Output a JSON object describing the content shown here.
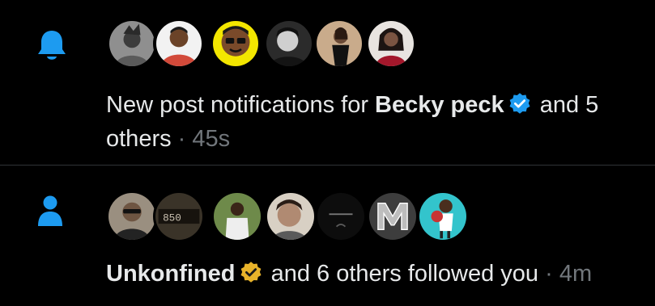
{
  "notifications": [
    {
      "type_icon": "bell-icon",
      "avatars": [
        "avatar-1",
        "avatar-2",
        "avatar-3",
        "avatar-4",
        "avatar-5",
        "avatar-6"
      ],
      "text_prefix": "New post notifications for",
      "user": "Becky peck",
      "badge": "verified-blue-icon",
      "text_suffix": "and 5",
      "text_line2": "others",
      "separator": "·",
      "time": "45s"
    },
    {
      "type_icon": "person-icon",
      "avatars": [
        "avatar-1",
        "avatar-2",
        "avatar-3",
        "avatar-4",
        "avatar-5",
        "avatar-6",
        "avatar-7"
      ],
      "user": "Unkonfined",
      "badge": "verified-gold-icon",
      "text_suffix": "and 6 others followed you",
      "separator": "·",
      "time": "4m"
    }
  ],
  "colors": {
    "background": "#000000",
    "text": "#e7e9ea",
    "muted": "#71767b",
    "accent_blue": "#1d9bf0",
    "gold": "#e8b32a",
    "divider": "#2f3336"
  }
}
